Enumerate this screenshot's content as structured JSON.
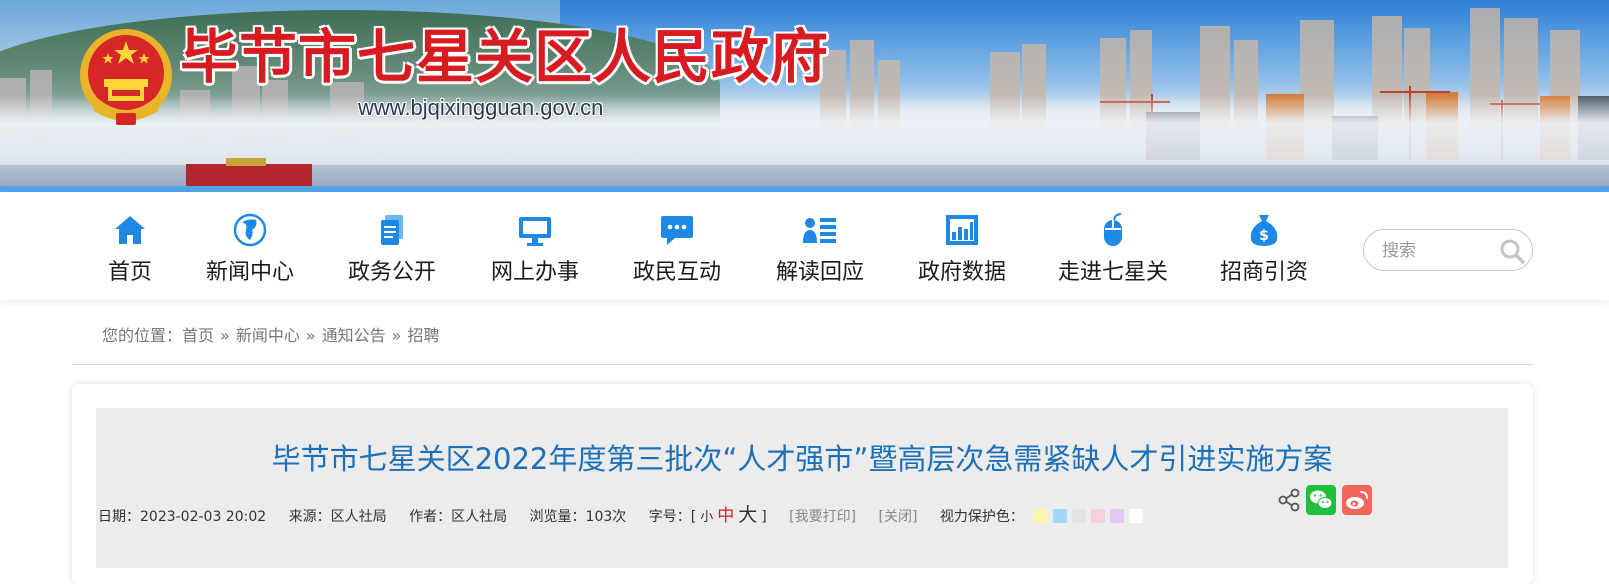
{
  "header": {
    "site_title": "毕节市七星关区人民政府",
    "site_url": "www.bjqixingguan.gov.cn"
  },
  "nav": {
    "items": [
      {
        "label": "首页",
        "icon": "home-icon"
      },
      {
        "label": "新闻中心",
        "icon": "globe-icon"
      },
      {
        "label": "政务公开",
        "icon": "document-icon"
      },
      {
        "label": "网上办事",
        "icon": "monitor-icon"
      },
      {
        "label": "政民互动",
        "icon": "chat-bubble-icon"
      },
      {
        "label": "解读回应",
        "icon": "user-list-icon"
      },
      {
        "label": "政府数据",
        "icon": "bar-chart-icon"
      },
      {
        "label": "走进七星关",
        "icon": "mouse-icon"
      },
      {
        "label": "招商引资",
        "icon": "money-bag-icon"
      }
    ],
    "search_placeholder": "搜索"
  },
  "breadcrumb": {
    "prefix": "您的位置：",
    "items": [
      "首页",
      "新闻中心",
      "通知公告",
      "招聘"
    ],
    "separator": "»"
  },
  "article": {
    "title": "毕节市七星关区2022年度第三批次“人才强市”暨高层次急需紧缺人才引进实施方案",
    "date": "日期：2023-02-03 20:02",
    "source": "来源：区人社局",
    "author": "作者：区人社局",
    "views": "浏览量：103次",
    "font_size_label": "字号：[",
    "font_small": "小",
    "font_medium": "中",
    "font_large": "大",
    "font_close_bracket": "]",
    "print": "[我要打印]",
    "close": "[关闭]",
    "eye_care_label": "视力保护色："
  },
  "colors": {
    "brand_red": "#d81b21",
    "title_blue": "#1d6fb8",
    "nav_icon_blue": "#1e88e5",
    "eye_care_swatches": [
      "#f9f5a9",
      "#a6d6f5",
      "#e3e3e3",
      "#f7cfe0",
      "#e6c9f2",
      "#ffffff"
    ]
  },
  "share": [
    "share-icon",
    "wechat-icon",
    "weibo-icon"
  ]
}
